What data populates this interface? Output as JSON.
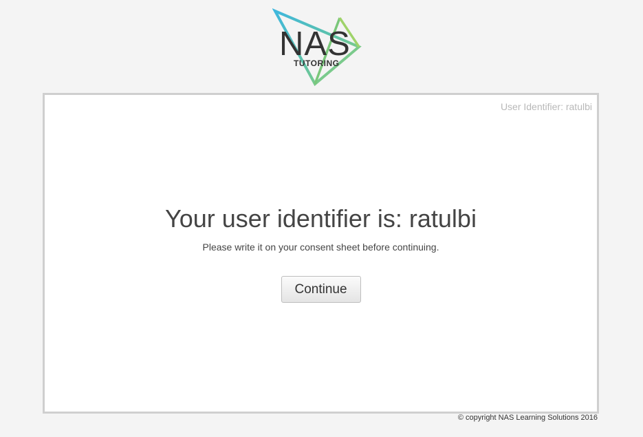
{
  "logo": {
    "word": "NAS",
    "sub": "TUTORING",
    "colors": {
      "cyan": "#49b8d8",
      "green": "#7ac77a",
      "lime": "#9fd36a",
      "text": "#333333"
    }
  },
  "panel": {
    "user_identifier_label": "User Identifier: ratulbi",
    "title": "Your user identifier is: ratulbi",
    "subtitle": "Please write it on your consent sheet before continuing.",
    "continue_label": "Continue"
  },
  "footer": {
    "copyright": "© copyright NAS Learning Solutions 2016"
  }
}
